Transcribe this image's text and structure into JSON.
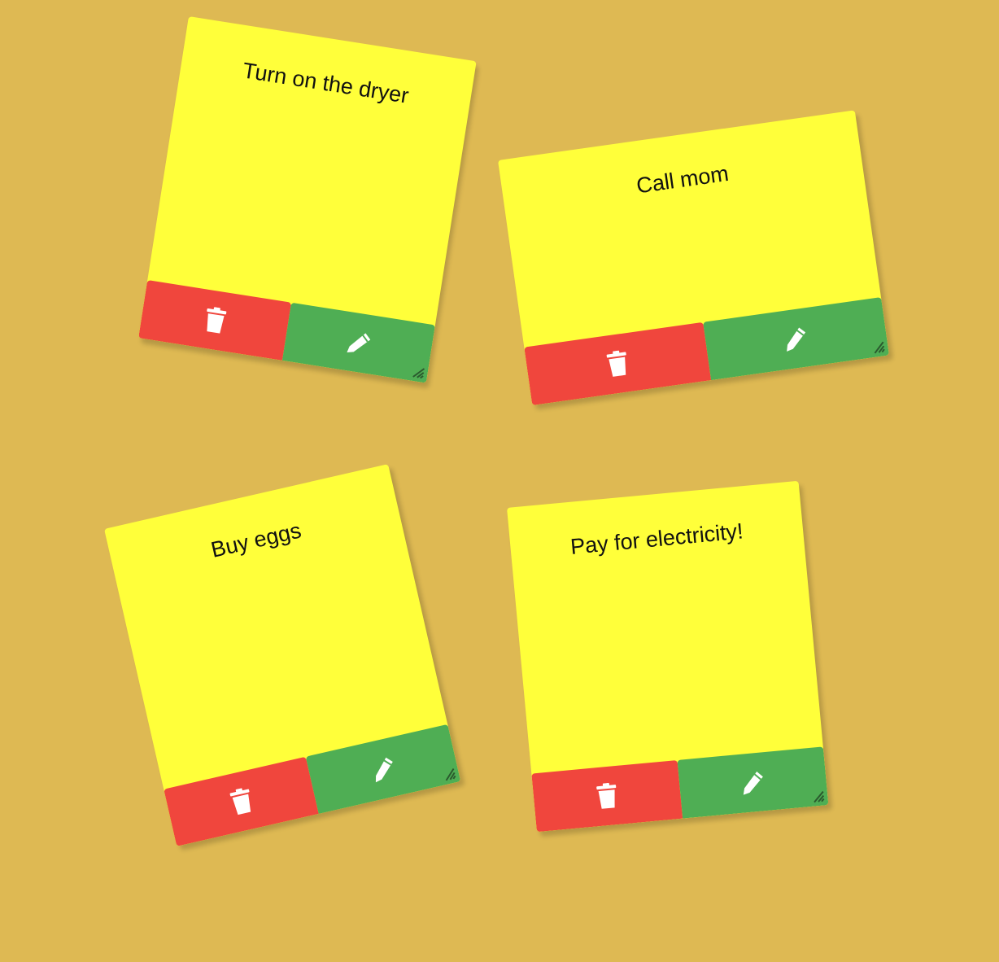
{
  "colors": {
    "board": "#DEB953",
    "note": "#FFFF3A",
    "delete_button": "#F0463D",
    "edit_button": "#4FAE54"
  },
  "notes": [
    {
      "text": "Turn on the dryer",
      "delete_icon": "trash-icon",
      "edit_icon": "pencil-icon"
    },
    {
      "text": "Call mom",
      "delete_icon": "trash-icon",
      "edit_icon": "pencil-icon"
    },
    {
      "text": "Buy eggs",
      "delete_icon": "trash-icon",
      "edit_icon": "pencil-icon"
    },
    {
      "text": "Pay for electricity!",
      "delete_icon": "trash-icon",
      "edit_icon": "pencil-icon"
    }
  ]
}
